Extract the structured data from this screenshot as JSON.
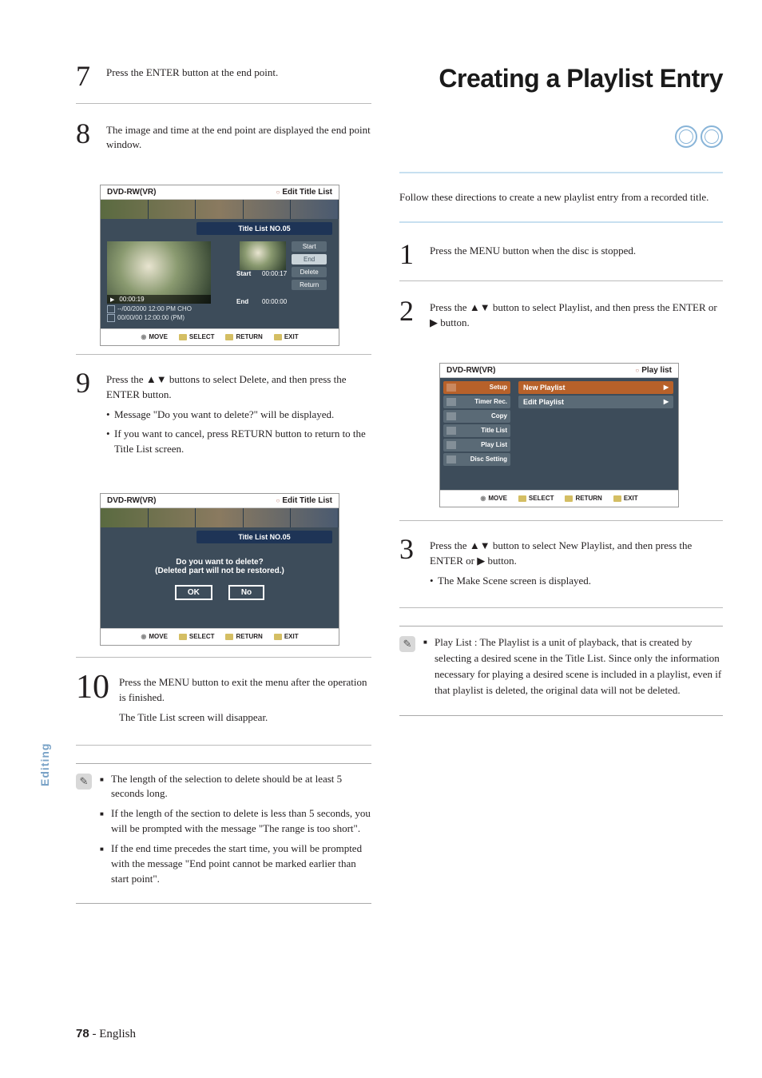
{
  "left": {
    "step7": {
      "num": "7",
      "text": "Press the ENTER button at the end point."
    },
    "step8": {
      "num": "8",
      "text": "The image and time at the end point are displayed the end point window.",
      "ss": {
        "titleL": "DVD-RW(VR)",
        "titleR": "Edit Title List",
        "badge": "Title List NO.05",
        "start_label": "Start",
        "start_val": "00:00:17",
        "end_label": "End",
        "end_val": "00:00:00",
        "playhead": "00:00:19",
        "meta1": "--/00/2000 12:00 PM CHO",
        "meta2": "00/00/00 12:00:00 (PM)",
        "btns": {
          "start": "Start",
          "end": "End",
          "delete": "Delete",
          "return": "Return"
        },
        "menu": {
          "move": "MOVE",
          "select": "SELECT",
          "return": "RETURN",
          "exit": "EXIT"
        }
      }
    },
    "step9": {
      "num": "9",
      "text": "Press the ▲▼ buttons to select Delete, and then press the ENTER button.",
      "b1": "Message \"Do you want to delete?\" will be displayed.",
      "b2": "If you want to cancel, press RETURN button to return to the Title List screen.",
      "ss": {
        "titleL": "DVD-RW(VR)",
        "titleR": "Edit Title List",
        "badge": "Title List NO.05",
        "dialog1": "Do you want to delete?",
        "dialog2": "(Deleted part will not be restored.)",
        "ok": "OK",
        "no": "No",
        "menu": {
          "move": "MOVE",
          "select": "SELECT",
          "return": "RETURN",
          "exit": "EXIT"
        }
      }
    },
    "step10": {
      "num": "10",
      "text1": "Press the MENU button to exit the menu after the operation is finished.",
      "text2": "The Title List screen will disappear."
    },
    "notes": {
      "n1": "The length of the selection to delete should be at least 5 seconds long.",
      "n2": "If the length of the section to delete is less than 5 seconds, you will be prompted with the message \"The range is too short\".",
      "n3": "If the end time precedes the start time, you will be prompted with the message \"End point cannot be marked earlier than start point\"."
    }
  },
  "right": {
    "heading": "Creating a Playlist Entry",
    "intro": "Follow these directions to create a new playlist entry from a recorded title.",
    "step1": {
      "num": "1",
      "text": "Press the MENU button when the disc is stopped."
    },
    "step2": {
      "num": "2",
      "text": "Press the ▲▼ button to select Playlist, and then press the ENTER or ▶ button.",
      "ss": {
        "titleL": "DVD-RW(VR)",
        "titleR": "Play list",
        "side": {
          "setup": "Setup",
          "timer": "Timer Rec.",
          "copy": "Copy",
          "title": "Title List",
          "play": "Play List",
          "disc": "Disc Setting"
        },
        "rows": {
          "new": "New Playlist",
          "edit": "Edit Playlist"
        },
        "menu": {
          "move": "MOVE",
          "select": "SELECT",
          "return": "RETURN",
          "exit": "EXIT"
        }
      }
    },
    "step3": {
      "num": "3",
      "text": "Press the ▲▼ button to select New Playlist, and then press the ENTER or ▶ button.",
      "b1": "The Make Scene screen is displayed."
    },
    "note": {
      "label": "Play List : ",
      "text": "The Playlist is a unit of playback, that is created by selecting a desired scene in the Title List. Since only the information necessary for playing a desired scene is included in a playlist, even if that playlist is deleted, the original data will not be deleted."
    }
  },
  "sideLabel": "Editing",
  "footer": {
    "page": "78",
    "dash": " - ",
    "lang": "English"
  }
}
